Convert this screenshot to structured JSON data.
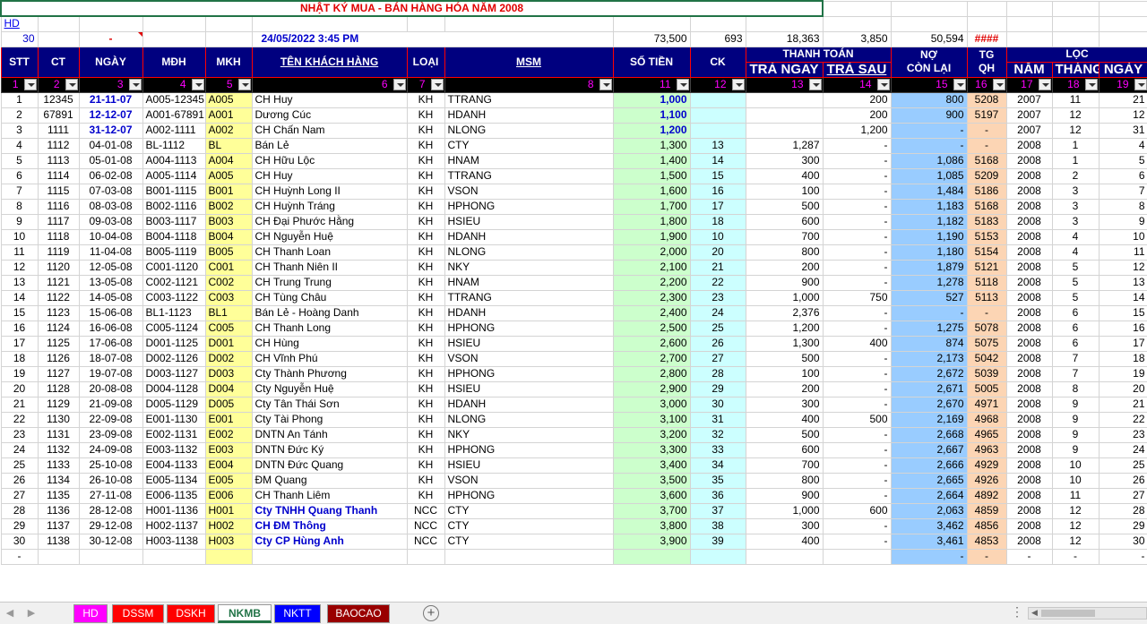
{
  "title": "NHẬT KÝ MUA - BÁN HÀNG HÓA NĂM 2008",
  "hd_link": "HD",
  "info": {
    "count": "30",
    "dash": "-",
    "datetime": "24/05/2022 3:45 PM",
    "total_sotien": "73,500",
    "total_ck": "693",
    "total_tra_ngay": "18,363",
    "total_tra_sau": "3,850",
    "total_no": "50,594",
    "hash": "####"
  },
  "headers": {
    "stt": "STT",
    "ct": "CT",
    "ngay": "NGÀY",
    "mdh": "MĐH",
    "mkh": "MKH",
    "ten_kh": "TÊN KHÁCH HÀNG",
    "loai": "LOẠI",
    "msm": "MSM",
    "so_tien": "SỐ TIỀN",
    "ck": "CK",
    "thanh_toan": "THANH TOÁN",
    "tra_ngay": "TRẢ NGAY",
    "tra_sau": "TRẢ SAU",
    "no_con_lai_1": "NỢ",
    "no_con_lai_2": "CÒN LẠI",
    "tg_qh_1": "TG",
    "tg_qh_2": "QH",
    "loc": "LỌC",
    "nam": "NĂM",
    "thang": "THÁNG",
    "ngay2": "NGÀY"
  },
  "filter_numbers": [
    "1",
    "2",
    "3",
    "4",
    "5",
    "6",
    "7",
    "8",
    "11",
    "12",
    "13",
    "14",
    "15",
    "16",
    "17",
    "18",
    "19"
  ],
  "rows": [
    [
      "1",
      "12345",
      "21-11-07",
      "A005-12345",
      "A005",
      "CH Huy",
      "KH",
      "TTRANG",
      "1,000",
      "",
      "",
      "200",
      "800",
      "5208",
      "2007",
      "11",
      "21"
    ],
    [
      "2",
      "67891",
      "12-12-07",
      "A001-67891",
      "A001",
      "Dương Cúc",
      "KH",
      "HDANH",
      "1,100",
      "",
      "",
      "200",
      "900",
      "5197",
      "2007",
      "12",
      "12"
    ],
    [
      "3",
      "1111",
      "31-12-07",
      "A002-1111",
      "A002",
      "CH Chấn Nam",
      "KH",
      "NLONG",
      "1,200",
      "",
      "",
      "1,200",
      "-",
      "-",
      "2007",
      "12",
      "31"
    ],
    [
      "4",
      "1112",
      "04-01-08",
      "BL-1112",
      "BL",
      "Bán Lẻ",
      "KH",
      "CTY",
      "1,300",
      "13",
      "1,287",
      "-",
      "-",
      "-",
      "2008",
      "1",
      "4"
    ],
    [
      "5",
      "1113",
      "05-01-08",
      "A004-1113",
      "A004",
      "CH Hữu Lộc",
      "KH",
      "HNAM",
      "1,400",
      "14",
      "300",
      "-",
      "1,086",
      "5168",
      "2008",
      "1",
      "5"
    ],
    [
      "6",
      "1114",
      "06-02-08",
      "A005-1114",
      "A005",
      "CH Huy",
      "KH",
      "TTRANG",
      "1,500",
      "15",
      "400",
      "-",
      "1,085",
      "5209",
      "2008",
      "2",
      "6"
    ],
    [
      "7",
      "1115",
      "07-03-08",
      "B001-1115",
      "B001",
      "CH Huỳnh Long II",
      "KH",
      "VSON",
      "1,600",
      "16",
      "100",
      "-",
      "1,484",
      "5186",
      "2008",
      "3",
      "7"
    ],
    [
      "8",
      "1116",
      "08-03-08",
      "B002-1116",
      "B002",
      "CH Huỳnh Tráng",
      "KH",
      "HPHONG",
      "1,700",
      "17",
      "500",
      "-",
      "1,183",
      "5168",
      "2008",
      "3",
      "8"
    ],
    [
      "9",
      "1117",
      "09-03-08",
      "B003-1117",
      "B003",
      "CH Đại Phước Hằng",
      "KH",
      "HSIEU",
      "1,800",
      "18",
      "600",
      "-",
      "1,182",
      "5183",
      "2008",
      "3",
      "9"
    ],
    [
      "10",
      "1118",
      "10-04-08",
      "B004-1118",
      "B004",
      "CH Nguyễn Huệ",
      "KH",
      "HDANH",
      "1,900",
      "10",
      "700",
      "-",
      "1,190",
      "5153",
      "2008",
      "4",
      "10"
    ],
    [
      "11",
      "1119",
      "11-04-08",
      "B005-1119",
      "B005",
      "CH Thanh Loan",
      "KH",
      "NLONG",
      "2,000",
      "20",
      "800",
      "-",
      "1,180",
      "5154",
      "2008",
      "4",
      "11"
    ],
    [
      "12",
      "1120",
      "12-05-08",
      "C001-1120",
      "C001",
      "CH Thanh Niên II",
      "KH",
      "NKY",
      "2,100",
      "21",
      "200",
      "-",
      "1,879",
      "5121",
      "2008",
      "5",
      "12"
    ],
    [
      "13",
      "1121",
      "13-05-08",
      "C002-1121",
      "C002",
      "CH Trung Trung",
      "KH",
      "HNAM",
      "2,200",
      "22",
      "900",
      "-",
      "1,278",
      "5118",
      "2008",
      "5",
      "13"
    ],
    [
      "14",
      "1122",
      "14-05-08",
      "C003-1122",
      "C003",
      "CH Tùng Châu",
      "KH",
      "TTRANG",
      "2,300",
      "23",
      "1,000",
      "750",
      "527",
      "5113",
      "2008",
      "5",
      "14"
    ],
    [
      "15",
      "1123",
      "15-06-08",
      "BL1-1123",
      "BL1",
      "Bán Lẻ - Hoàng Danh",
      "KH",
      "HDANH",
      "2,400",
      "24",
      "2,376",
      "-",
      "-",
      "-",
      "2008",
      "6",
      "15"
    ],
    [
      "16",
      "1124",
      "16-06-08",
      "C005-1124",
      "C005",
      "CH Thanh Long",
      "KH",
      "HPHONG",
      "2,500",
      "25",
      "1,200",
      "-",
      "1,275",
      "5078",
      "2008",
      "6",
      "16"
    ],
    [
      "17",
      "1125",
      "17-06-08",
      "D001-1125",
      "D001",
      "CH Hùng",
      "KH",
      "HSIEU",
      "2,600",
      "26",
      "1,300",
      "400",
      "874",
      "5075",
      "2008",
      "6",
      "17"
    ],
    [
      "18",
      "1126",
      "18-07-08",
      "D002-1126",
      "D002",
      "CH Vĩnh Phú",
      "KH",
      "VSON",
      "2,700",
      "27",
      "500",
      "-",
      "2,173",
      "5042",
      "2008",
      "7",
      "18"
    ],
    [
      "19",
      "1127",
      "19-07-08",
      "D003-1127",
      "D003",
      "Cty Thành Phương",
      "KH",
      "HPHONG",
      "2,800",
      "28",
      "100",
      "-",
      "2,672",
      "5039",
      "2008",
      "7",
      "19"
    ],
    [
      "20",
      "1128",
      "20-08-08",
      "D004-1128",
      "D004",
      "Cty Nguyễn Huệ",
      "KH",
      "HSIEU",
      "2,900",
      "29",
      "200",
      "-",
      "2,671",
      "5005",
      "2008",
      "8",
      "20"
    ],
    [
      "21",
      "1129",
      "21-09-08",
      "D005-1129",
      "D005",
      "Cty Tân Thái Sơn",
      "KH",
      "HDANH",
      "3,000",
      "30",
      "300",
      "-",
      "2,670",
      "4971",
      "2008",
      "9",
      "21"
    ],
    [
      "22",
      "1130",
      "22-09-08",
      "E001-1130",
      "E001",
      "Cty Tài Phong",
      "KH",
      "NLONG",
      "3,100",
      "31",
      "400",
      "500",
      "2,169",
      "4968",
      "2008",
      "9",
      "22"
    ],
    [
      "23",
      "1131",
      "23-09-08",
      "E002-1131",
      "E002",
      "DNTN An Tánh",
      "KH",
      "NKY",
      "3,200",
      "32",
      "500",
      "-",
      "2,668",
      "4965",
      "2008",
      "9",
      "23"
    ],
    [
      "24",
      "1132",
      "24-09-08",
      "E003-1132",
      "E003",
      "DNTN Đức Ký",
      "KH",
      "HPHONG",
      "3,300",
      "33",
      "600",
      "-",
      "2,667",
      "4963",
      "2008",
      "9",
      "24"
    ],
    [
      "25",
      "1133",
      "25-10-08",
      "E004-1133",
      "E004",
      "DNTN Đức Quang",
      "KH",
      "HSIEU",
      "3,400",
      "34",
      "700",
      "-",
      "2,666",
      "4929",
      "2008",
      "10",
      "25"
    ],
    [
      "26",
      "1134",
      "26-10-08",
      "E005-1134",
      "E005",
      "ĐM Quang",
      "KH",
      "VSON",
      "3,500",
      "35",
      "800",
      "-",
      "2,665",
      "4926",
      "2008",
      "10",
      "26"
    ],
    [
      "27",
      "1135",
      "27-11-08",
      "E006-1135",
      "E006",
      "CH Thanh Liêm",
      "KH",
      "HPHONG",
      "3,600",
      "36",
      "900",
      "-",
      "2,664",
      "4892",
      "2008",
      "11",
      "27"
    ],
    [
      "28",
      "1136",
      "28-12-08",
      "H001-1136",
      "H001",
      "Cty TNHH Quang Thanh",
      "NCC",
      "CTY",
      "3,700",
      "37",
      "1,000",
      "600",
      "2,063",
      "4859",
      "2008",
      "12",
      "28"
    ],
    [
      "29",
      "1137",
      "29-12-08",
      "H002-1137",
      "H002",
      "CH ĐM Thông",
      "NCC",
      "CTY",
      "3,800",
      "38",
      "300",
      "-",
      "3,462",
      "4856",
      "2008",
      "12",
      "29"
    ],
    [
      "30",
      "1138",
      "30-12-08",
      "H003-1138",
      "H003",
      "Cty CP Hùng Anh",
      "NCC",
      "CTY",
      "3,900",
      "39",
      "400",
      "-",
      "3,461",
      "4853",
      "2008",
      "12",
      "30"
    ],
    [
      "-",
      "",
      "",
      "",
      "",
      "",
      "",
      "",
      "",
      "",
      "",
      "",
      "-",
      "-",
      "-",
      "-",
      "-"
    ]
  ],
  "tabs": [
    {
      "label": "HD",
      "color": "#ff00ff"
    },
    {
      "label": "DSSM",
      "color": "#ff0000"
    },
    {
      "label": "DSKH",
      "color": "#ff0000"
    },
    {
      "label": "NKMB",
      "color": "#ffffff",
      "active": true
    },
    {
      "label": "NKTT",
      "color": "#0000ff"
    },
    {
      "label": "BAOCAO",
      "color": "#990000"
    }
  ]
}
